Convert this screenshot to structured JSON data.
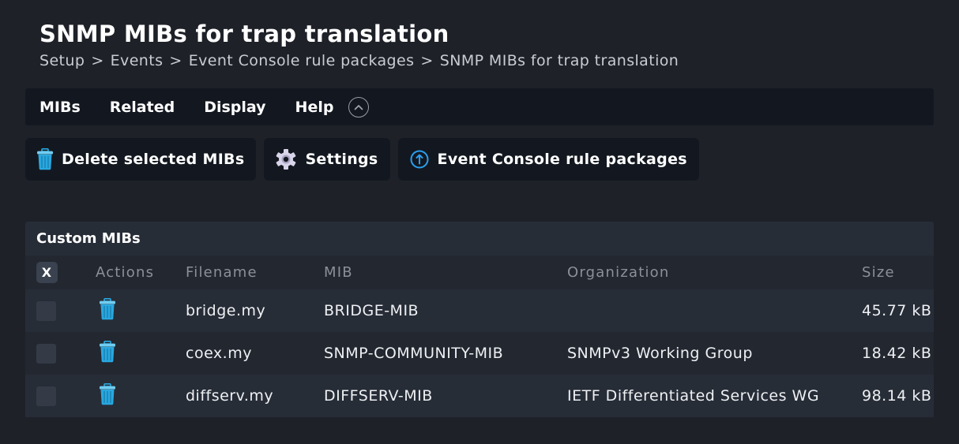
{
  "page": {
    "title": "SNMP MIBs for trap translation",
    "breadcrumb": [
      "Setup",
      "Events",
      "Event Console rule packages",
      "SNMP MIBs for trap translation"
    ],
    "breadcrumb_separator": ">"
  },
  "menu": {
    "items": [
      {
        "label": "MIBs"
      },
      {
        "label": "Related"
      },
      {
        "label": "Display"
      },
      {
        "label": "Help"
      }
    ],
    "collapse_icon": "chevron-up-circle-icon"
  },
  "actions": [
    {
      "label": "Delete selected MIBs",
      "icon": "trash-icon"
    },
    {
      "label": "Settings",
      "icon": "gear-icon"
    },
    {
      "label": "Event Console rule packages",
      "icon": "arrow-up-circle-icon"
    }
  ],
  "table": {
    "title": "Custom MIBs",
    "toggle_all_label": "X",
    "columns": [
      "Actions",
      "Filename",
      "MIB",
      "Organization",
      "Size"
    ],
    "rows": [
      {
        "filename": "bridge.my",
        "mib": "BRIDGE-MIB",
        "organization": "",
        "size": "45.77 kB"
      },
      {
        "filename": "coex.my",
        "mib": "SNMP-COMMUNITY-MIB",
        "organization": "SNMPv3 Working Group",
        "size": "18.42 kB"
      },
      {
        "filename": "diffserv.my",
        "mib": "DIFFSERV-MIB",
        "organization": "IETF Differentiated Services WG",
        "size": "98.14 kB"
      }
    ]
  },
  "colors": {
    "background": "#1e2128",
    "menubar": "#131820",
    "panel": "#272d37",
    "row_alt": "#222730",
    "icon_blue": "#29a8e0",
    "gear": "#d8d4ea"
  }
}
